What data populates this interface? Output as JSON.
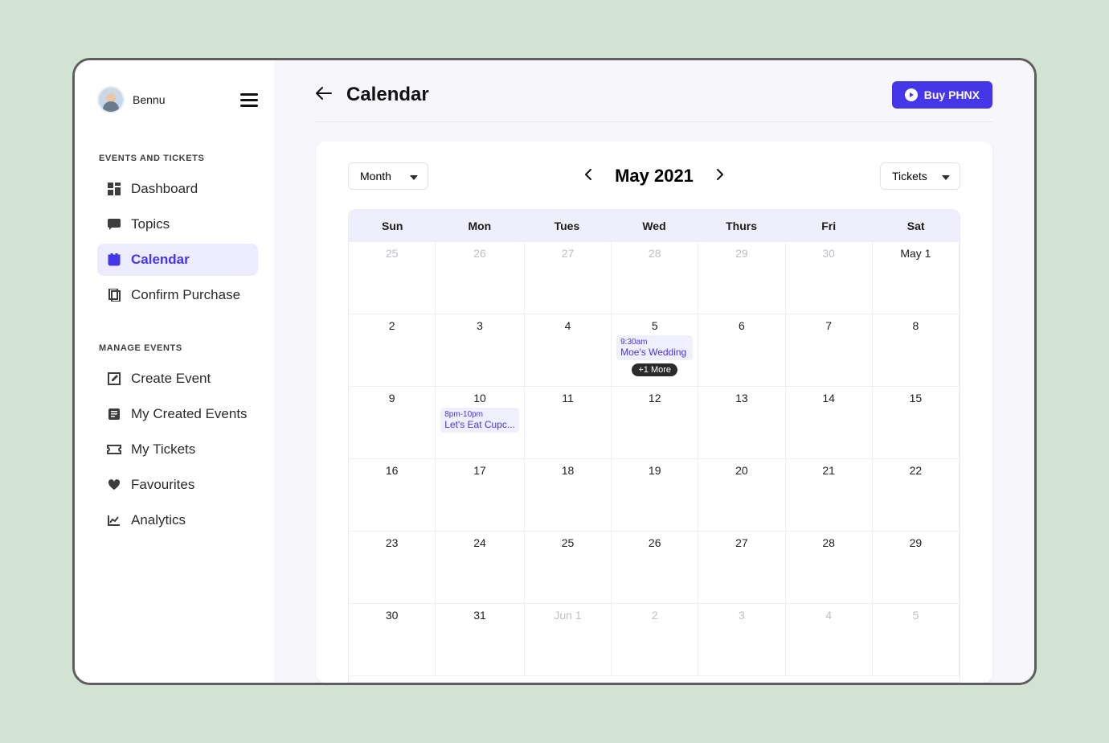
{
  "user": {
    "name": "Bennu"
  },
  "sidebar": {
    "section1_title": "EVENTS AND TICKETS",
    "section2_title": "MANAGE EVENTS",
    "items1": [
      {
        "label": "Dashboard",
        "icon": "dashboard-icon",
        "active": false
      },
      {
        "label": "Topics",
        "icon": "topics-icon",
        "active": false
      },
      {
        "label": "Calendar",
        "icon": "calendar-icon",
        "active": true
      },
      {
        "label": "Confirm Purchase",
        "icon": "confirm-icon",
        "active": false
      }
    ],
    "items2": [
      {
        "label": "Create Event",
        "icon": "create-icon"
      },
      {
        "label": "My Created Events",
        "icon": "list-icon"
      },
      {
        "label": "My Tickets",
        "icon": "ticket-icon"
      },
      {
        "label": "Favourites",
        "icon": "heart-icon"
      },
      {
        "label": "Analytics",
        "icon": "analytics-icon"
      }
    ]
  },
  "header": {
    "title": "Calendar",
    "buy_label": "Buy PHNX"
  },
  "calendar": {
    "view_selector": "Month",
    "filter_selector": "Tickets",
    "period_label": "May 2021",
    "day_headers": [
      "Sun",
      "Mon",
      "Tues",
      "Wed",
      "Thurs",
      "Fri",
      "Sat"
    ],
    "weeks": [
      [
        {
          "num": "25",
          "muted": true
        },
        {
          "num": "26",
          "muted": true
        },
        {
          "num": "27",
          "muted": true
        },
        {
          "num": "28",
          "muted": true
        },
        {
          "num": "29",
          "muted": true
        },
        {
          "num": "30",
          "muted": true
        },
        {
          "num": "May 1",
          "muted": false
        }
      ],
      [
        {
          "num": "2"
        },
        {
          "num": "3"
        },
        {
          "num": "4"
        },
        {
          "num": "5",
          "events": [
            {
              "time": "9:30am",
              "title": "Moe's Wedding"
            }
          ],
          "more": "+1 More"
        },
        {
          "num": "6"
        },
        {
          "num": "7"
        },
        {
          "num": "8"
        }
      ],
      [
        {
          "num": "9"
        },
        {
          "num": "10",
          "events": [
            {
              "time": "8pm-10pm",
              "title": "Let's Eat Cupc..."
            }
          ]
        },
        {
          "num": "11"
        },
        {
          "num": "12"
        },
        {
          "num": "13"
        },
        {
          "num": "14"
        },
        {
          "num": "15"
        }
      ],
      [
        {
          "num": "16"
        },
        {
          "num": "17"
        },
        {
          "num": "18"
        },
        {
          "num": "19"
        },
        {
          "num": "20"
        },
        {
          "num": "21"
        },
        {
          "num": "22"
        }
      ],
      [
        {
          "num": "23"
        },
        {
          "num": "24"
        },
        {
          "num": "25"
        },
        {
          "num": "26"
        },
        {
          "num": "27"
        },
        {
          "num": "28"
        },
        {
          "num": "29"
        }
      ],
      [
        {
          "num": "30"
        },
        {
          "num": "31"
        },
        {
          "num": "Jun 1",
          "muted": true
        },
        {
          "num": "2",
          "muted": true
        },
        {
          "num": "3",
          "muted": true
        },
        {
          "num": "4",
          "muted": true
        },
        {
          "num": "5",
          "muted": true
        }
      ]
    ]
  }
}
